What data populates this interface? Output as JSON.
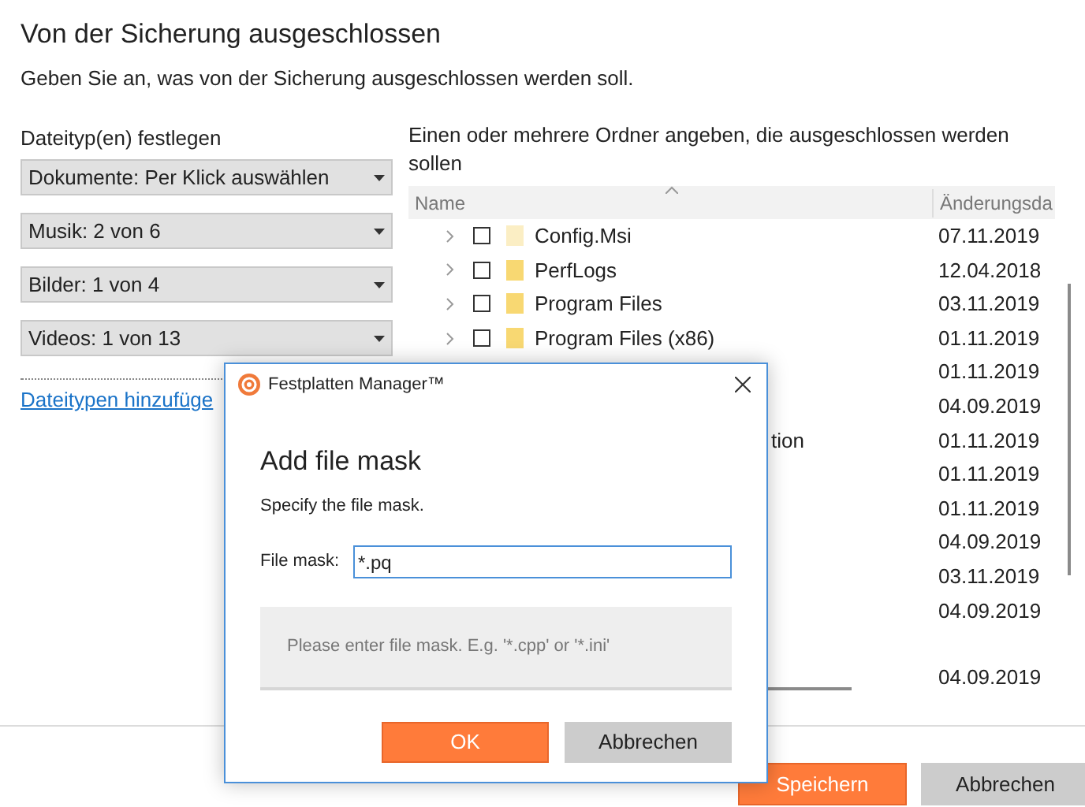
{
  "window": {
    "title": "Von der Sicherung ausgeschlossen",
    "subtitle": "Geben Sie an, was von der Sicherung ausgeschlossen werden soll."
  },
  "file_types": {
    "label": "Dateityp(en) festlegen",
    "dropdowns": [
      {
        "value": "Dokumente: Per Klick auswählen"
      },
      {
        "value": "Musik: 2 von 6"
      },
      {
        "value": "Bilder: 1 von 4"
      },
      {
        "value": "Videos: 1 von 13"
      }
    ],
    "link": "Dateitypen hinzufüge"
  },
  "folders": {
    "label": "Einen oder mehrere Ordner angeben, die ausgeschlossen werden sollen",
    "columns": [
      "Name",
      "Änderungsda"
    ],
    "rows": [
      {
        "name": "Config.Msi",
        "checked": false,
        "date": "07.11.2019",
        "dimmed": true
      },
      {
        "name": "PerfLogs",
        "checked": false,
        "date": "12.04.2018",
        "dimmed": false
      },
      {
        "name": "Program Files",
        "checked": false,
        "date": "03.11.2019",
        "dimmed": false
      },
      {
        "name": "Program Files (x86)",
        "checked": false,
        "date": "01.11.2019",
        "dimmed": false
      },
      {
        "date": "01.11.2019"
      },
      {
        "date": "04.09.2019"
      },
      {
        "name_tail": "tion",
        "date": "01.11.2019"
      },
      {
        "date": "01.11.2019"
      },
      {
        "date": "01.11.2019"
      },
      {
        "date": "04.09.2019"
      },
      {
        "date": "03.11.2019"
      },
      {
        "date": "04.09.2019"
      },
      {
        "date": "04.09.2019"
      }
    ]
  },
  "buttons": [
    {
      "label": "Speichern",
      "kind": "primary"
    },
    {
      "label": "Abbrechen",
      "kind": "secondary"
    }
  ],
  "dialog": {
    "title": "Festplatten Manager™",
    "heading": "Add file mask",
    "description": "Specify the file mask.",
    "field_label": "File mask:",
    "value": "*.pq",
    "hint": "Please enter file mask. E.g. '*.cpp' or '*.ini'",
    "buttons": [
      {
        "label": "OK",
        "kind": "primary"
      },
      {
        "label": "Abbrechen",
        "kind": "secondary"
      }
    ]
  }
}
